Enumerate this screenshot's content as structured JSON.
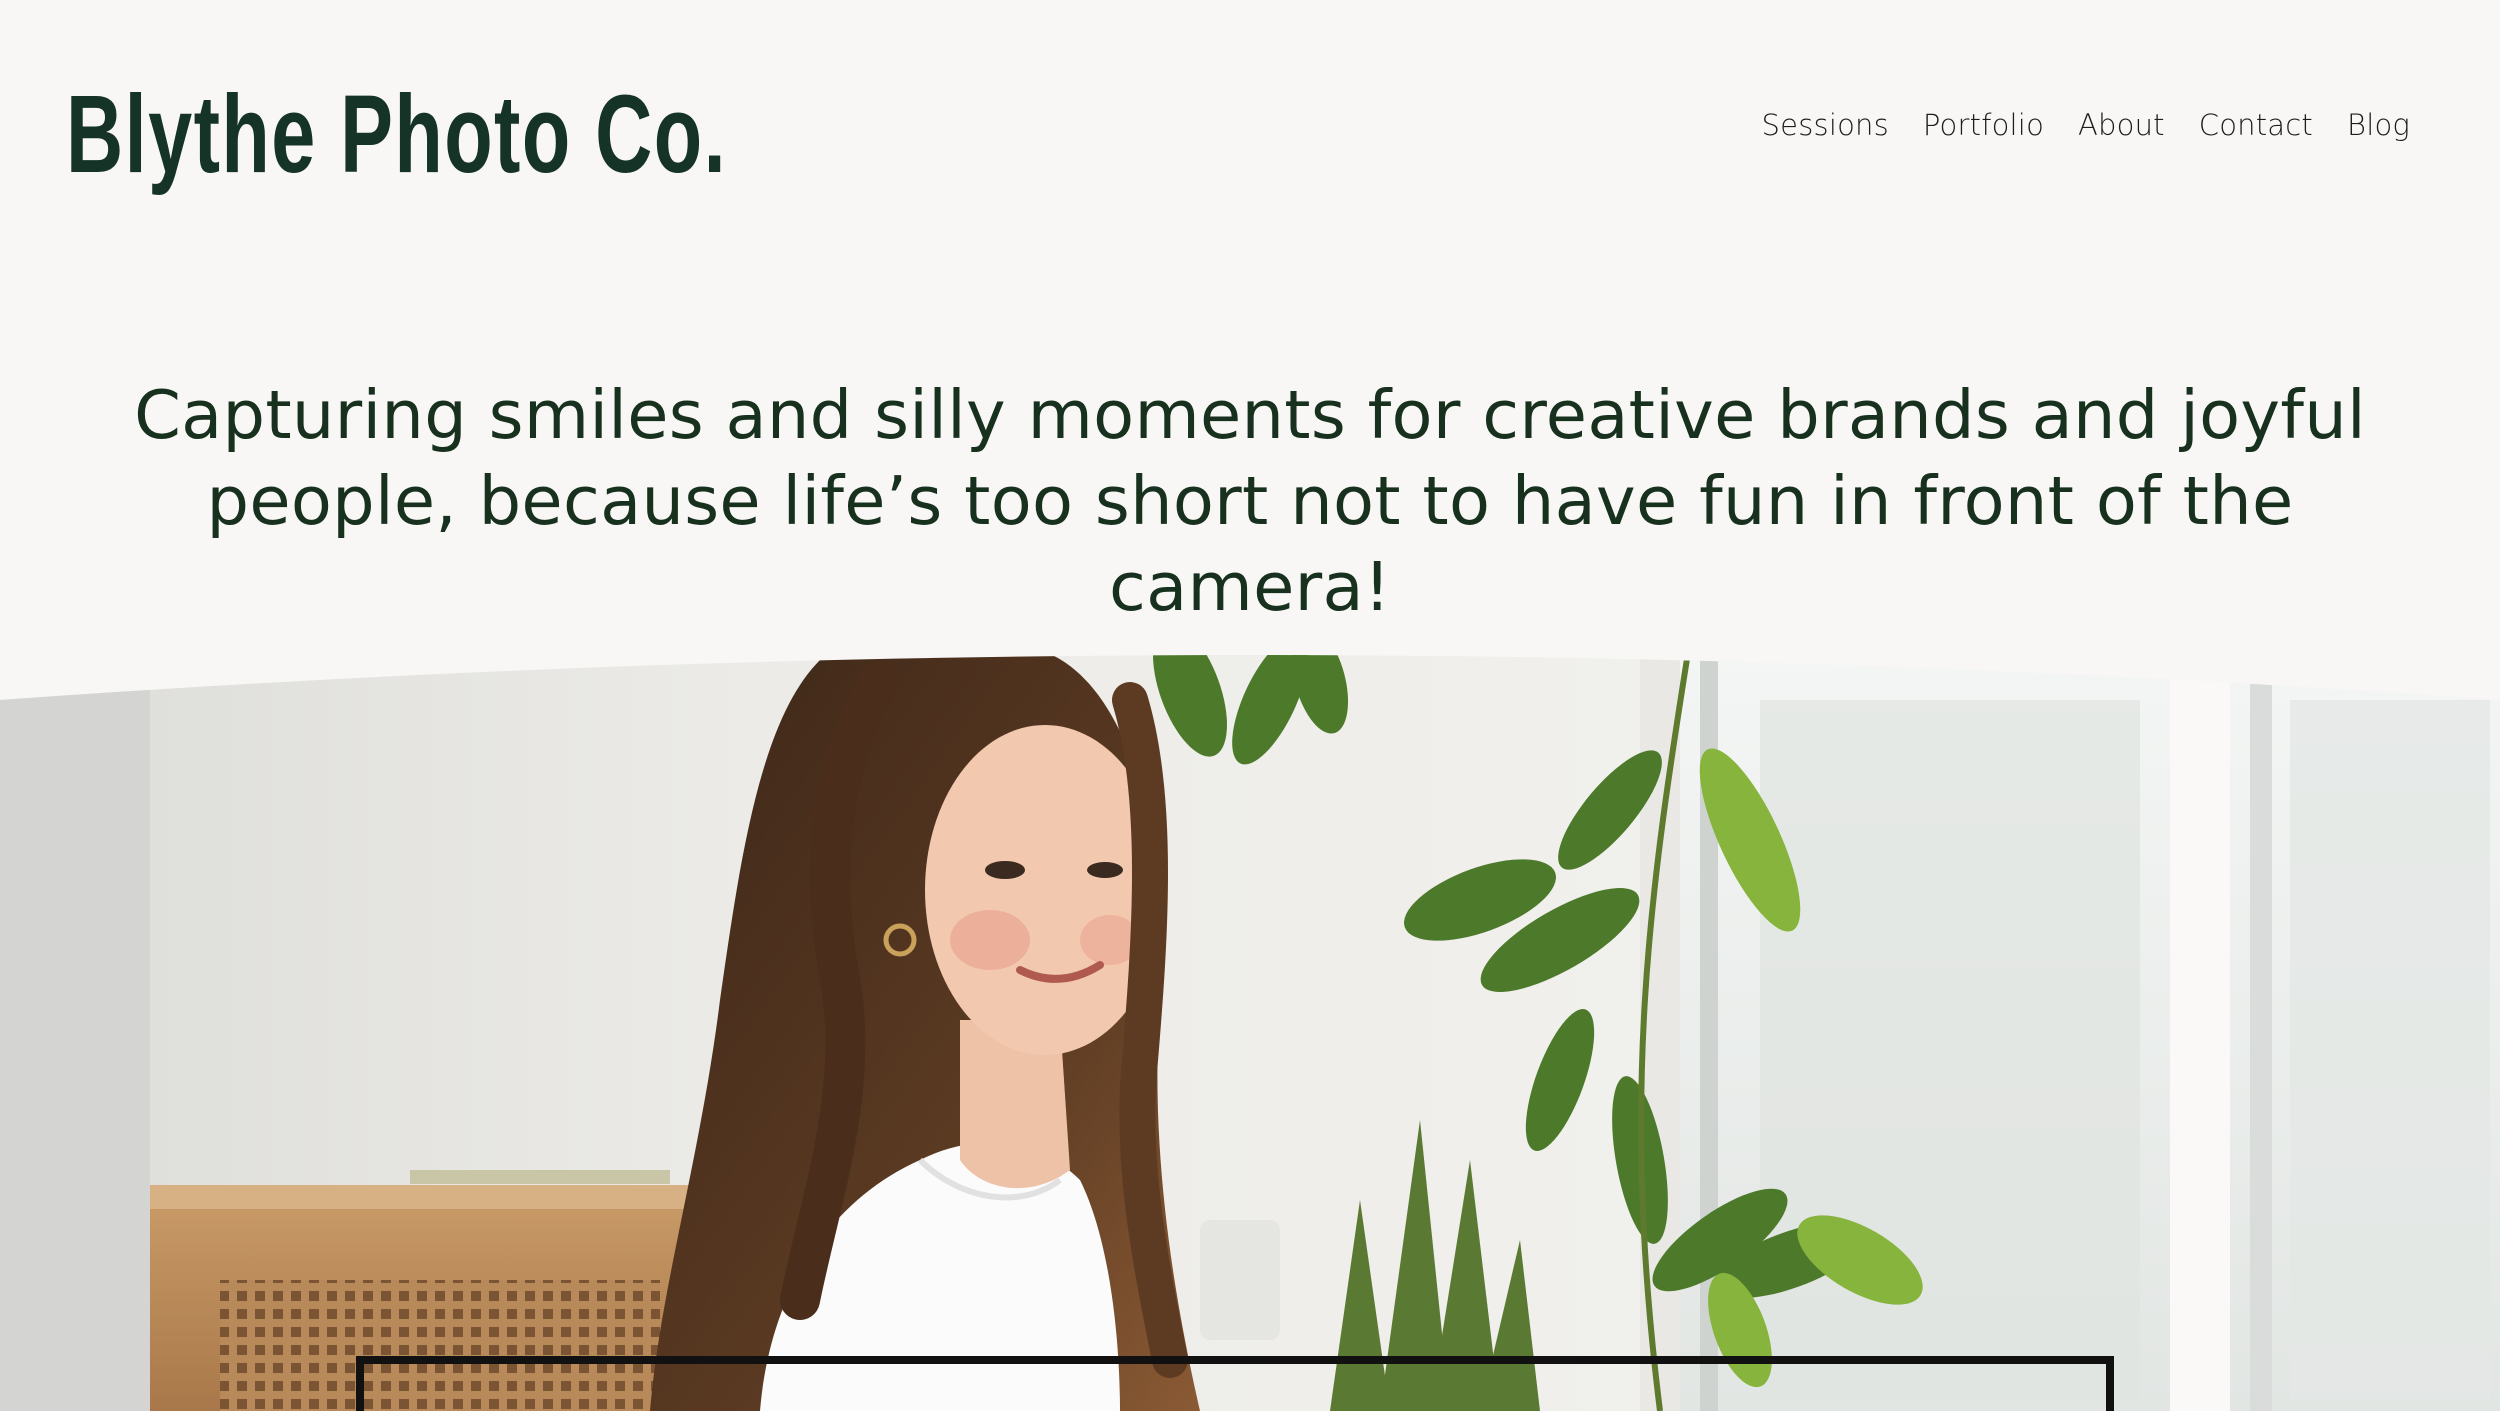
{
  "site": {
    "logo_text": "Blythe Photo Co.",
    "brand_color": "#153326"
  },
  "nav": {
    "items": [
      {
        "label": "Sessions"
      },
      {
        "label": "Portfolio"
      },
      {
        "label": "About"
      },
      {
        "label": "Contact"
      },
      {
        "label": "Blog"
      }
    ]
  },
  "hero": {
    "tagline": "Capturing smiles and silly moments for creative brands and joyful people, because life’s too short not to have fun in front of the camera!",
    "image_subject": "smiling woman with long brown hair in white shirt beside a trailing houseplant near a sunny window",
    "background_color": "#f9f7f6",
    "text_color": "#18311f"
  }
}
